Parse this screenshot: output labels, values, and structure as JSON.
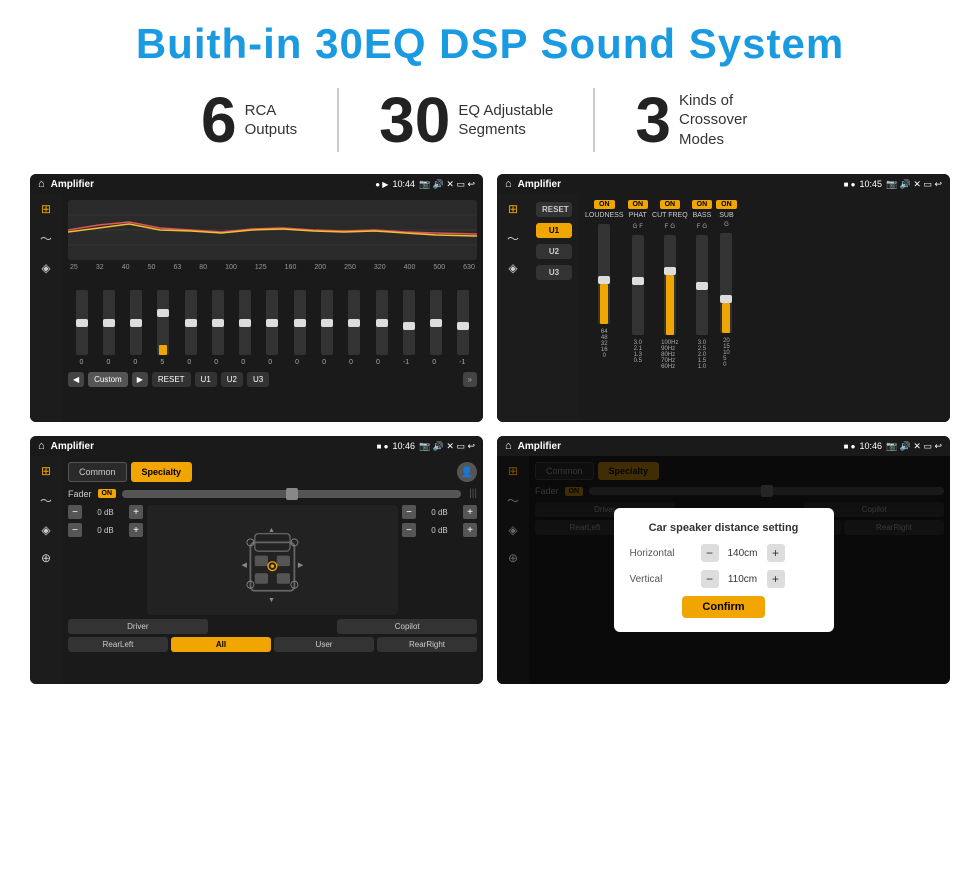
{
  "title": "Buith-in 30EQ DSP Sound System",
  "stats": [
    {
      "number": "6",
      "label": "RCA\nOutputs"
    },
    {
      "number": "30",
      "label": "EQ Adjustable\nSegments"
    },
    {
      "number": "3",
      "label": "Kinds of\nCrossover Modes"
    }
  ],
  "screens": [
    {
      "id": "screen1",
      "statusBar": {
        "appName": "Amplifier",
        "time": "10:44"
      },
      "type": "eq"
    },
    {
      "id": "screen2",
      "statusBar": {
        "appName": "Amplifier",
        "time": "10:45"
      },
      "type": "crossover"
    },
    {
      "id": "screen3",
      "statusBar": {
        "appName": "Amplifier",
        "time": "10:46"
      },
      "type": "speaker"
    },
    {
      "id": "screen4",
      "statusBar": {
        "appName": "Amplifier",
        "time": "10:46"
      },
      "type": "dialog",
      "dialog": {
        "title": "Car speaker distance setting",
        "horizontal": {
          "label": "Horizontal",
          "value": "140cm"
        },
        "vertical": {
          "label": "Vertical",
          "value": "110cm"
        },
        "confirmLabel": "Confirm"
      }
    }
  ],
  "eqFreqs": [
    "25",
    "32",
    "40",
    "50",
    "63",
    "80",
    "100",
    "125",
    "160",
    "200",
    "250",
    "320",
    "400",
    "500",
    "630"
  ],
  "eqValues": [
    "0",
    "0",
    "0",
    "5",
    "0",
    "0",
    "0",
    "0",
    "0",
    "0",
    "0",
    "0",
    "-1",
    "0",
    "-1"
  ],
  "eqButtons": [
    "Custom",
    "RESET",
    "U1",
    "U2",
    "U3"
  ],
  "crossover": {
    "presets": [
      "U1",
      "U2",
      "U3"
    ],
    "cols": [
      {
        "toggle": "ON",
        "label": "LOUDNESS"
      },
      {
        "toggle": "ON",
        "label": "PHAT"
      },
      {
        "toggle": "ON",
        "label": "CUT FREQ"
      },
      {
        "toggle": "ON",
        "label": "BASS"
      },
      {
        "toggle": "ON",
        "label": "SUB"
      }
    ]
  },
  "speaker": {
    "tabs": [
      "Common",
      "Specialty"
    ],
    "faderLabel": "Fader",
    "toggleLabel": "ON",
    "volumeRows": [
      {
        "value": "0 dB"
      },
      {
        "value": "0 dB"
      },
      {
        "value": "0 dB"
      },
      {
        "value": "0 dB"
      }
    ],
    "bottomBtns": [
      "Driver",
      "",
      "Copilot",
      "RearLeft",
      "All",
      "User",
      "RearRight"
    ]
  },
  "dialog": {
    "title": "Car speaker distance setting",
    "horizontal": {
      "label": "Horizontal",
      "value": "140cm"
    },
    "vertical": {
      "label": "Vertical",
      "value": "110cm"
    },
    "confirmLabel": "Confirm"
  }
}
